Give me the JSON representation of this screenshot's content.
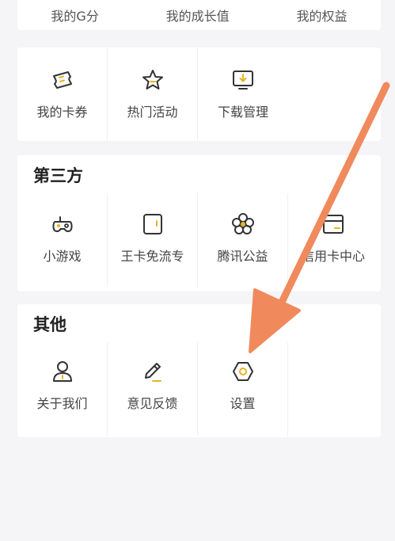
{
  "top_row": [
    "我的G分",
    "我的成长值",
    "我的权益"
  ],
  "tools": {
    "items": [
      {
        "label": "我的卡券",
        "icon": "ticket-icon"
      },
      {
        "label": "热门活动",
        "icon": "star-icon"
      },
      {
        "label": "下载管理",
        "icon": "download-monitor-icon"
      }
    ]
  },
  "third_party": {
    "title": "第三方",
    "items": [
      {
        "label": "小游戏",
        "icon": "gamepad-icon"
      },
      {
        "label": "王卡免流专",
        "icon": "sim-card-icon"
      },
      {
        "label": "腾讯公益",
        "icon": "flower-icon"
      },
      {
        "label": "信用卡中心",
        "icon": "credit-card-icon"
      }
    ]
  },
  "other": {
    "title": "其他",
    "items": [
      {
        "label": "关于我们",
        "icon": "person-icon"
      },
      {
        "label": "意见反馈",
        "icon": "pencil-icon"
      },
      {
        "label": "设置",
        "icon": "hexagon-settings-icon"
      }
    ]
  },
  "colors": {
    "icon_stroke": "#333333",
    "icon_accent": "#e6b422",
    "arrow": "#f08a5d"
  }
}
